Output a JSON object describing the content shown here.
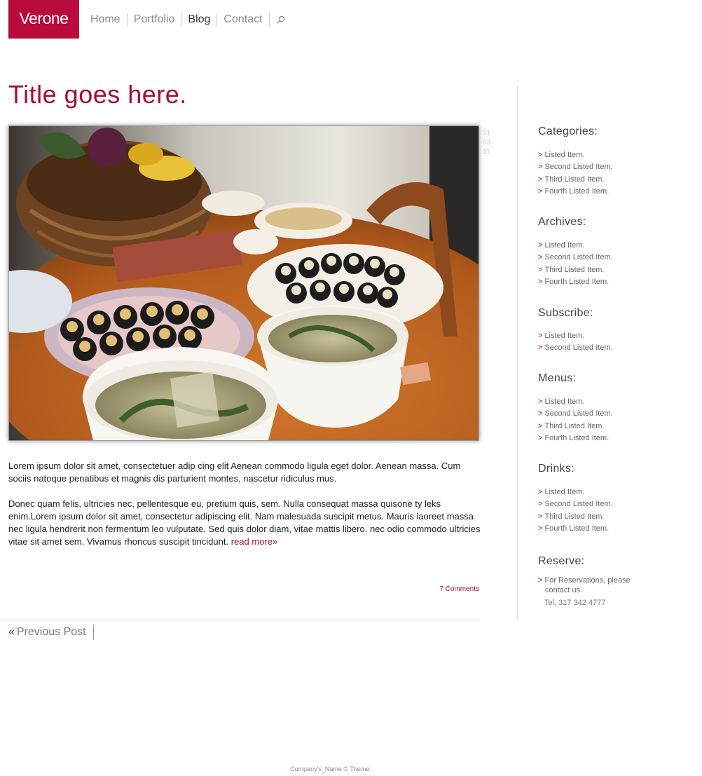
{
  "header": {
    "logo": "Verone",
    "nav": [
      "Home",
      "Portfolio",
      "Blog",
      "Contact"
    ],
    "active_nav": "Blog",
    "search_icon": "search-icon"
  },
  "post": {
    "title": "Title goes here.",
    "image_alt": "food-photo",
    "date": [
      "31",
      "03",
      "11"
    ],
    "paragraph1": "Lorem ipsum dolor sit amet, consectetuer adip cing elit Aenean commodo ligula eget dolor. Aenean massa. Cum sociis natoque penatibus et magnis dis parturient montes, nascetur ridiculus mus.",
    "paragraph2": "Donec quam felis, ultricies nec, pellentesque eu, pretium quis, sem. Nulla consequat massa quisone ty leks enim.Lorem ipsum dolor sit amet, consectetur adipiscing elit. Nam malesuada suscipit metus. Mauris laoreet massa nec ligula hendrerit non fermentum leo vulputate. Sed quis dolor diam, vitae mattis libero.  nec odio commodo ultricies vitae sit amet sem. Vivamus rhoncus suscipit tincidunt.",
    "read_more": "read more»",
    "comments": "7 Comments",
    "prev_arrow": "«",
    "prev_label": "Previous Post"
  },
  "sidebar": {
    "arrow": ">",
    "widgets": [
      {
        "title": "Categories:",
        "items": [
          "Listed Item.",
          "Second Listed Item.",
          "Third Listed Item.",
          "Fourth Listed Item."
        ]
      },
      {
        "title": "Archives:",
        "items": [
          "Listed Item.",
          "Second Listed Item.",
          "Third Listed Item.",
          "Fourth Listed Item."
        ]
      },
      {
        "title": "Subscribe:",
        "items": [
          "Listed Item.",
          "Second Listed Item."
        ]
      },
      {
        "title": "Menus:",
        "items": [
          "Listed Item.",
          "Second Listed Item.",
          "Third Listed Item.",
          "Fourth Listed Item."
        ]
      },
      {
        "title": "Drinks:",
        "items": [
          "Listed Item.",
          "Second Listed Item.",
          "Third Listed Item.",
          "Fourth Listed Item."
        ]
      }
    ],
    "reserve": {
      "title": "Reserve:",
      "text_line1": "For Reservations, please",
      "text_line2": "contact us.",
      "tel": "Tel.  317 342 4777"
    }
  },
  "footer": {
    "text": "Company's_Name © Theme."
  },
  "colors": {
    "brand": "#b80b3c",
    "accent": "#a60c3a"
  }
}
